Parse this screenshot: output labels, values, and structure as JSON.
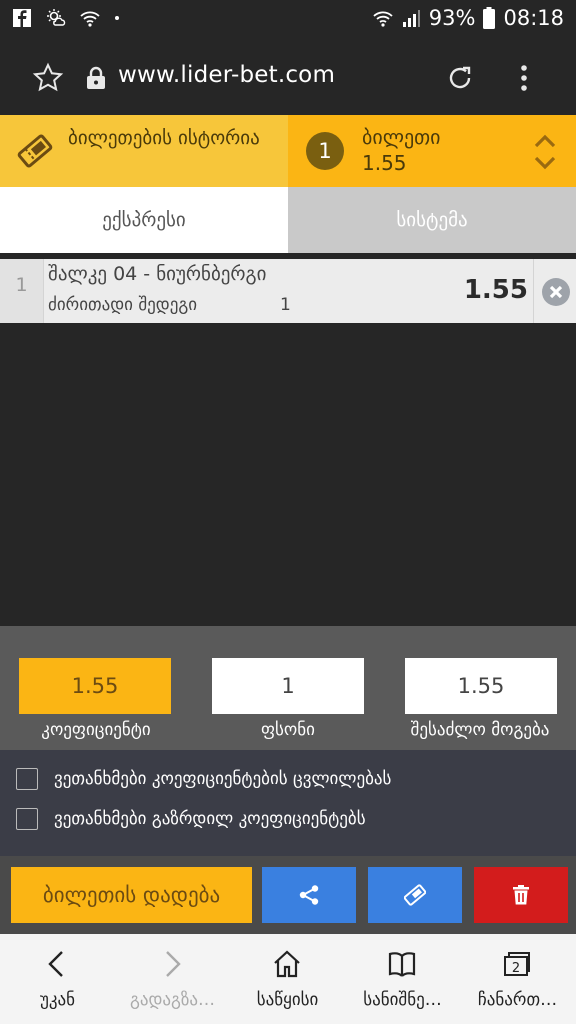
{
  "status_bar": {
    "battery_percent": "93%",
    "time": "08:18"
  },
  "browser": {
    "url": "www.lider-bet.com"
  },
  "ticket_header": {
    "history_label": "ბილეთების ისტორია",
    "ticket_count": "1",
    "ticket_title": "ბილეთი",
    "ticket_odds": "1.55"
  },
  "tabs": {
    "express": "ექსპრესი",
    "system": "სისტემა"
  },
  "bet": {
    "index": "1",
    "match": "შალკე 04 - ნიურნბერგი",
    "market": "ძირითადი შედეგი",
    "pick": "1",
    "odds": "1.55"
  },
  "summary": {
    "odds_value": "1.55",
    "stake_value": "1",
    "win_value": "1.55",
    "odds_label": "კოეფიციენტი",
    "stake_label": "ფსონი",
    "win_label": "შესაძლო მოგება"
  },
  "options": {
    "accept_changes": "ვეთანხმები კოეფიციენტების ცვლილებას",
    "accept_boosted": "ვეთანხმები გაზრდილ კოეფიციენტებს"
  },
  "actions": {
    "place_bet": "ბილეთის დადება"
  },
  "bottom_nav": {
    "back": "უკან",
    "forward": "გადაგზა…",
    "home": "საწყისი",
    "bookmarks": "სანიშნე…",
    "tabs": "ჩანართ…",
    "tab_count": "2"
  },
  "colors": {
    "accent": "#fbb514",
    "header_left": "#f7c63a",
    "share_blue": "#3a80e0",
    "delete_red": "#d31c1c"
  }
}
